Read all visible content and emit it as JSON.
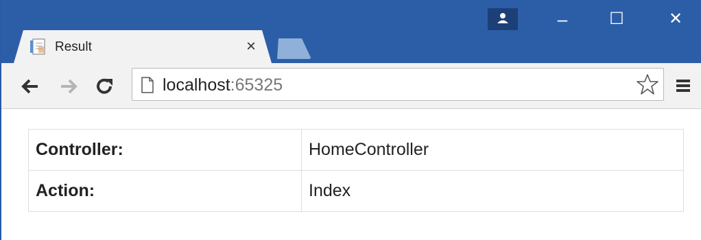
{
  "browser": {
    "tab": {
      "title": "Result",
      "favicon": "document-icon",
      "close_glyph": "×"
    },
    "window_controls": {
      "minimize": "–",
      "maximize": "☐",
      "close": "✕"
    },
    "toolbar": {
      "back": "arrow-left-icon",
      "forward": "arrow-right-icon",
      "reload": "reload-icon",
      "url_host": "localhost",
      "url_port": ":65325",
      "bookmark": "star-icon",
      "menu": "hamburger-menu-icon"
    }
  },
  "page": {
    "rows": [
      {
        "label": "Controller:",
        "value": "HomeController"
      },
      {
        "label": "Action:",
        "value": "Index"
      }
    ]
  },
  "colors": {
    "titlebar": "#2c5ea8",
    "toolbar": "#f2f2f2"
  }
}
